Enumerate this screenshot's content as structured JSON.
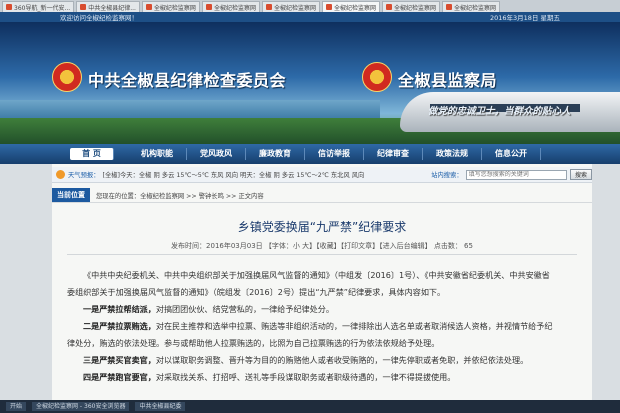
{
  "browser": {
    "tabs": [
      {
        "label": "360导航_新一代安...",
        "active": false
      },
      {
        "label": "中共全椒县纪律...",
        "active": false
      },
      {
        "label": "全椒纪检监察网",
        "active": false
      },
      {
        "label": "全椒纪检监察网",
        "active": false
      },
      {
        "label": "全椒纪检监察网",
        "active": false
      },
      {
        "label": "全椒纪检监察网",
        "active": true
      },
      {
        "label": "全椒纪检监察网",
        "active": false
      },
      {
        "label": "全椒纪检监察网",
        "active": false
      }
    ]
  },
  "header": {
    "welcome": "欢迎访问全椒纪检监察网！",
    "date": "2016年3月18日 星期五",
    "title_left": "中共全椒县纪律检查委员会",
    "title_right": "全椒县监察局",
    "slogan": "做党的忠诚卫士，当群众的贴心人"
  },
  "nav": {
    "items": [
      "首 页",
      "机构职能",
      "党风政风",
      "廉政教育",
      "信访举报",
      "纪律审查",
      "政策法规",
      "信息公开"
    ]
  },
  "infobar": {
    "weather_label": "天气预报：",
    "weather_text": "[全椒]今天：全椒 阴 多云 15℃～5℃ 东风 风向 明天：全椒 阴 多云 15℃～2℃ 东北风 风向",
    "search_label": "站内搜索：",
    "search_placeholder": "填写您想搜索的关键词",
    "search_button": "搜索"
  },
  "breadcrumb": {
    "tag": "当前位置",
    "path": "您现在的位置：全椒纪检监察网 >> 警钟长鸣 >> 正文内容"
  },
  "article": {
    "title": "乡镇党委换届“九严禁”纪律要求",
    "meta": "发布时间：2016年03月03日 【字体：小 大】【收藏】【打印文章】【进入后台编辑】 点击数： 65",
    "paragraphs": [
      {
        "lead": "",
        "text": "《中共中央纪委机关、中共中央组织部关于加强换届风气监督的通知》（中组发〔2016〕1号）、《中共安徽省纪委机关、中共安徽省",
        "indent": true
      },
      {
        "lead": "",
        "text": "委组织部关于加强换届风气监督的通知》（皖组发〔2016〕2号）提出“九严禁”纪律要求，具体内容如下。",
        "indent": false
      },
      {
        "lead": "一是严禁拉帮结派，",
        "text": "对搞团团伙伙、结党营私的，一律给予纪律处分。",
        "indent": true
      },
      {
        "lead": "二是严禁拉票贿选，",
        "text": "对在民主推荐和选举中拉票、贿选等非组织活动的，一律排除出人选名单或者取消候选人资格，并视情节给予纪",
        "indent": true
      },
      {
        "lead": "",
        "text": "律处分，贿选的依法处理。参与或帮助他人拉票贿选的，比照为自己拉票贿选的行为依法依规给予处理。",
        "indent": false
      },
      {
        "lead": "三是严禁买官卖官，",
        "text": "对以谋取职务调整、晋升等为目的的贿赂他人或者收受贿赂的，一律先停职或者免职，并依纪依法处理。",
        "indent": true
      },
      {
        "lead": "四是严禁跑官要官，",
        "text": "对采取找关系、打招呼、送礼等手段谋取职务或者职级待遇的，一律不得提拔使用。",
        "indent": true
      }
    ]
  },
  "taskbar": {
    "items": [
      "开始",
      "全椒纪检监察网 - 360安全浏览器",
      "中共全椒县纪委"
    ]
  },
  "colors": {
    "nav_bg": "#1d4f86",
    "accent": "#1a5da8",
    "title": "#1a3a6c"
  }
}
